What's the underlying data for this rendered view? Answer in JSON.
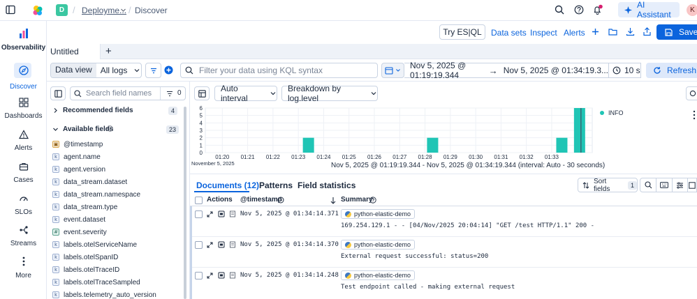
{
  "topbar": {
    "space_letter": "D",
    "breadcrumb_1": "Deployme...",
    "breadcrumb_2": "Discover",
    "ai_assistant": "AI Assistant",
    "avatar_letter": "K"
  },
  "sidenav": {
    "items": [
      {
        "label": "Observability"
      },
      {
        "label": "Discover"
      },
      {
        "label": "Dashboards"
      },
      {
        "label": "Alerts"
      },
      {
        "label": "Cases"
      },
      {
        "label": "SLOs"
      },
      {
        "label": "Streams"
      },
      {
        "label": "More"
      }
    ]
  },
  "subbar": {
    "try_esql": "Try ES|QL",
    "data_sets": "Data sets",
    "inspect": "Inspect",
    "alerts": "Alerts",
    "save": "Save"
  },
  "tabs": {
    "active": "Untitled",
    "add": "+"
  },
  "querybar": {
    "data_view_label": "Data view",
    "data_view_value": "All logs",
    "search_placeholder": "Filter your data using KQL syntax",
    "date_start": "Nov 5, 2025 @ 01:19:19.344",
    "date_arrow": "→",
    "date_end": "Nov 5, 2025 @ 01:34:19.3...",
    "refresh_interval": "10 s",
    "refresh": "Refresh"
  },
  "fieldlist": {
    "search_placeholder": "Search field names",
    "filter_count": "0",
    "recommended_label": "Recommended fields",
    "recommended_count": "4",
    "available_label": "Available fields",
    "available_count": "23",
    "fields": [
      {
        "name": "@timestamp",
        "type": "date"
      },
      {
        "name": "agent.name",
        "type": "keyword"
      },
      {
        "name": "agent.version",
        "type": "keyword"
      },
      {
        "name": "data_stream.dataset",
        "type": "keyword"
      },
      {
        "name": "data_stream.namespace",
        "type": "keyword"
      },
      {
        "name": "data_stream.type",
        "type": "keyword"
      },
      {
        "name": "event.dataset",
        "type": "keyword"
      },
      {
        "name": "event.severity",
        "type": "number"
      },
      {
        "name": "labels.otelServiceName",
        "type": "keyword"
      },
      {
        "name": "labels.otelSpanID",
        "type": "keyword"
      },
      {
        "name": "labels.otelTraceID",
        "type": "keyword"
      },
      {
        "name": "labels.otelTraceSampled",
        "type": "keyword"
      },
      {
        "name": "labels.telemetry_auto_version",
        "type": "keyword"
      }
    ]
  },
  "histogram_toolbar": {
    "interval": "Auto interval",
    "breakdown": "Breakdown by log.level"
  },
  "chart_data": {
    "type": "bar",
    "x": [
      "01:20",
      "01:21",
      "01:22",
      "01:23",
      "01:24",
      "01:25",
      "01:26",
      "01:27",
      "01:28",
      "01:29",
      "01:30",
      "01:31",
      "01:32",
      "01:33"
    ],
    "xsub": "November 5, 2025",
    "ylim": [
      0,
      6
    ],
    "yticks": [
      "0",
      "1",
      "2",
      "3",
      "4",
      "5",
      "6"
    ],
    "series": [
      {
        "name": "INFO",
        "color": "#20c5b5"
      }
    ],
    "bars": [
      {
        "t": 23.4,
        "value": 2
      },
      {
        "t": 28.3,
        "value": 2
      },
      {
        "t": 33.4,
        "value": 2
      },
      {
        "t": 34.1,
        "value": 6
      }
    ],
    "caption": "Nov 5, 2025 @ 01:19:19.344 - Nov 5, 2025 @ 01:34:19.344 (interval: Auto - 30 seconds)"
  },
  "doc_tabs": {
    "documents": "Documents (12)",
    "patterns": "Patterns",
    "field_statistics": "Field statistics",
    "sort_fields": "Sort fields",
    "sort_count": "1"
  },
  "table": {
    "col_actions": "Actions",
    "col_timestamp": "@timestamp",
    "col_summary": "Summary",
    "rows": [
      {
        "timestamp": "Nov 5, 2025 @ 01:34:14.371",
        "service": "python-elastic-demo",
        "message": "169.254.129.1 - - [04/Nov/2025 20:04:14] \"GET /test HTTP/1.1\" 200 -"
      },
      {
        "timestamp": "Nov 5, 2025 @ 01:34:14.370",
        "service": "python-elastic-demo",
        "message": "External request successful: status=200"
      },
      {
        "timestamp": "Nov 5, 2025 @ 01:34:14.248",
        "service": "python-elastic-demo",
        "message": "Test endpoint called - making external request"
      }
    ]
  }
}
